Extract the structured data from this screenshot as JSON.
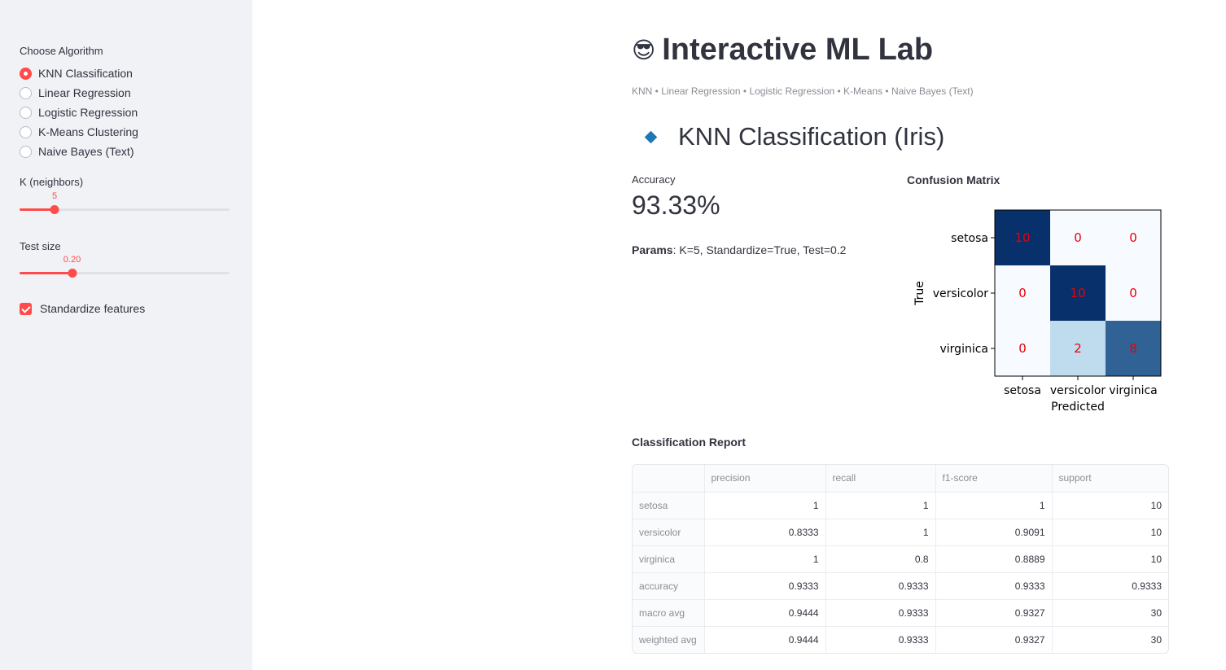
{
  "sidebar": {
    "algorithm_label": "Choose Algorithm",
    "algorithms": [
      {
        "label": "KNN Classification",
        "selected": true
      },
      {
        "label": "Linear Regression",
        "selected": false
      },
      {
        "label": "Logistic Regression",
        "selected": false
      },
      {
        "label": "K-Means Clustering",
        "selected": false
      },
      {
        "label": "Naive Bayes (Text)",
        "selected": false
      }
    ],
    "k_slider": {
      "label": "K (neighbors)",
      "value": "5",
      "fraction": 0.167
    },
    "test_slider": {
      "label": "Test size",
      "value": "0.20",
      "fraction": 0.25
    },
    "standardize": {
      "label": "Standardize features",
      "checked": true
    },
    "accent_color": "#ff4b4b"
  },
  "main": {
    "title_emoji": "😎",
    "title": "Interactive ML Lab",
    "caption": "KNN • Linear Regression • Logistic Regression • K-Means • Naive Bayes (Text)",
    "section_title": "KNN Classification (Iris)",
    "accuracy_label": "Accuracy",
    "accuracy_value": "93.33%",
    "params_label": "Params",
    "params_value": ": K=5, Standardize=True, Test=0.2",
    "cm_heading": "Confusion Matrix",
    "report_heading": "Classification Report"
  },
  "chart_data": {
    "type": "heatmap",
    "xlabel": "Predicted",
    "ylabel": "True",
    "x_categories": [
      "setosa",
      "versicolor",
      "virginica"
    ],
    "y_categories": [
      "setosa",
      "versicolor",
      "virginica"
    ],
    "values": [
      [
        10,
        0,
        0
      ],
      [
        0,
        10,
        0
      ],
      [
        0,
        2,
        8
      ]
    ],
    "colormap": "Blues",
    "annotation_color": "#e8000b"
  },
  "report": {
    "columns": [
      "",
      "precision",
      "recall",
      "f1-score",
      "support"
    ],
    "rows": [
      [
        "setosa",
        "1",
        "1",
        "1",
        "10"
      ],
      [
        "versicolor",
        "0.8333",
        "1",
        "0.9091",
        "10"
      ],
      [
        "virginica",
        "1",
        "0.8",
        "0.8889",
        "10"
      ],
      [
        "accuracy",
        "0.9333",
        "0.9333",
        "0.9333",
        "0.9333"
      ],
      [
        "macro avg",
        "0.9444",
        "0.9333",
        "0.9327",
        "30"
      ],
      [
        "weighted avg",
        "0.9444",
        "0.9333",
        "0.9327",
        "30"
      ]
    ]
  }
}
